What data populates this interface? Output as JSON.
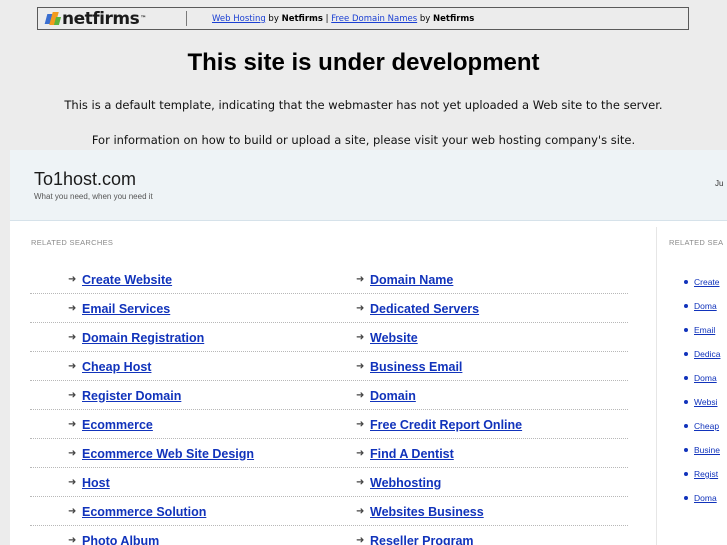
{
  "banner": {
    "logo_text": "netfirms",
    "link1": "Web Hosting",
    "by1": " by ",
    "brand1": "Netfirms",
    "sep": " | ",
    "link2": "Free Domain Names",
    "by2": " by ",
    "brand2": "Netfirms"
  },
  "notice": {
    "title": "This site is under development",
    "line1": "This is a default template, indicating that the webmaster has not yet uploaded a Web site to the server.",
    "line2": "For information on how to build or upload a site, please visit your web hosting company's site."
  },
  "parked": {
    "domain": "To1host.com",
    "tagline": "What you need, when you need it",
    "right_partial": "Ju",
    "related_label": "RELATED SEARCHES",
    "related_label_right": "RELATED SEA",
    "left_column": [
      "Create Website",
      "Email Services",
      "Domain Registration",
      "Cheap Host",
      "Register Domain",
      "Ecommerce",
      "Ecommerce Web Site Design",
      "Host",
      "Ecommerce Solution",
      "Photo Album"
    ],
    "right_column": [
      "Domain Name",
      "Dedicated Servers",
      "Website",
      "Business Email",
      "Domain",
      "Free Credit Report Online",
      "Find A Dentist",
      "Webhosting",
      "Websites Business",
      "Reseller Program"
    ],
    "sidebar_links": [
      "Create",
      "Doma",
      "Email",
      "Dedica",
      "Doma",
      "Websi",
      "Cheap",
      "Busine",
      "Regist",
      "Doma"
    ],
    "arrow_glyph": "➜"
  }
}
